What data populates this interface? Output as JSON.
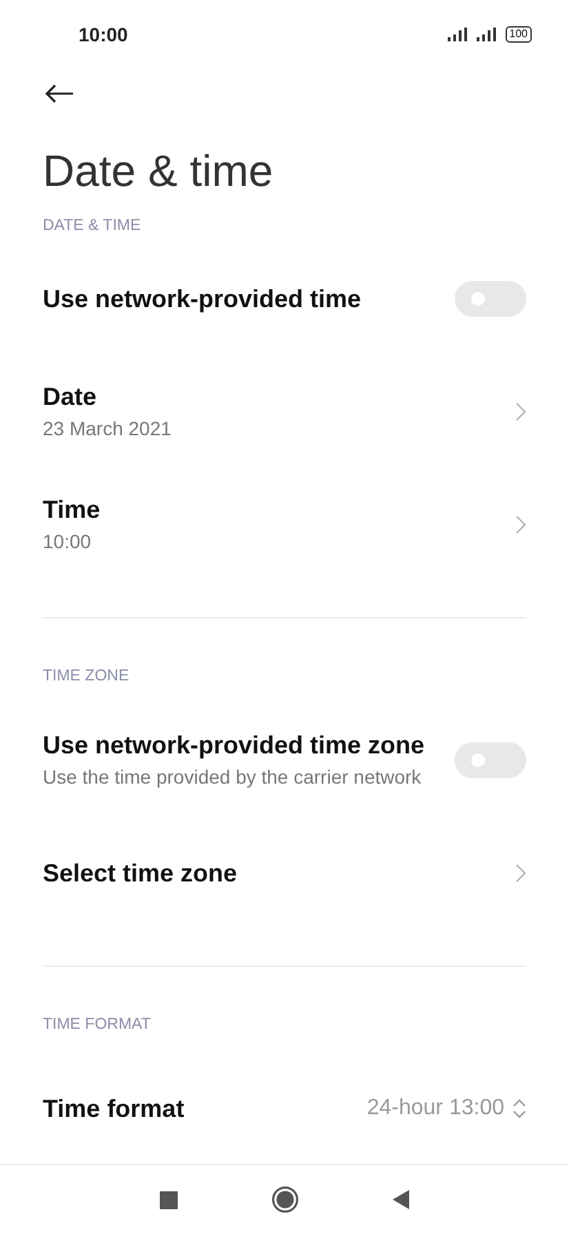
{
  "status_bar": {
    "time": "10:00",
    "battery": "100"
  },
  "title": "Date & time",
  "sections": [
    {
      "header": "DATE & TIME",
      "items": [
        {
          "kind": "toggle",
          "title": "Use network-provided time",
          "on": false
        },
        {
          "kind": "link",
          "title": "Date",
          "subtitle": "23 March 2021"
        },
        {
          "kind": "link",
          "title": "Time",
          "subtitle": "10:00"
        }
      ]
    },
    {
      "header": "TIME ZONE",
      "items": [
        {
          "kind": "toggle",
          "title": "Use network-provided time zone",
          "subtitle": "Use the time provided by the carrier network",
          "on": false
        },
        {
          "kind": "link",
          "title": "Select time zone"
        }
      ]
    },
    {
      "header": "TIME FORMAT",
      "items": [
        {
          "kind": "select",
          "title": "Time format",
          "value": "24-hour 13:00"
        }
      ]
    }
  ]
}
